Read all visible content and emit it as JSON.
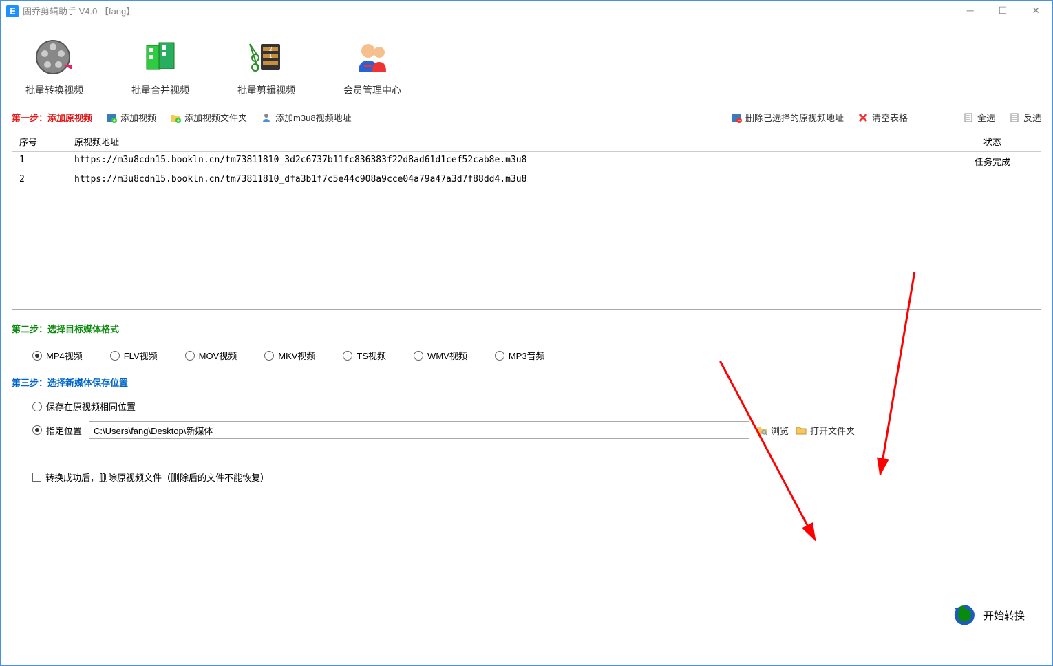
{
  "titlebar": {
    "text": "固乔剪辑助手 V4.0   【fang】"
  },
  "toolbar": {
    "convert": "批量转换视频",
    "merge": "批量合并视频",
    "clip": "批量剪辑视频",
    "member": "会员管理中心"
  },
  "step1": {
    "label": "第一步：添加原视频",
    "addVideo": "添加视频",
    "addFolder": "添加视频文件夹",
    "addM3u8": "添加m3u8视频地址",
    "delSelected": "删除已选择的原视频地址",
    "clearTable": "清空表格",
    "selectAll": "全选",
    "invert": "反选"
  },
  "table": {
    "headers": {
      "seq": "序号",
      "url": "原视频地址",
      "status": "状态"
    },
    "rows": [
      {
        "seq": "1",
        "url": "https://m3u8cdn15.bookln.cn/tm73811810_3d2c6737b11fc836383f22d8ad61d1cef52cab8e.m3u8",
        "status": "任务完成"
      },
      {
        "seq": "2",
        "url": "https://m3u8cdn15.bookln.cn/tm73811810_dfa3b1f7c5e44c908a9cce04a79a47a3d7f88dd4.m3u8",
        "status": ""
      }
    ]
  },
  "step2": {
    "label": "第二步：选择目标媒体格式",
    "options": [
      "MP4视频",
      "FLV视频",
      "MOV视频",
      "MKV视频",
      "TS视频",
      "WMV视频",
      "MP3音频"
    ]
  },
  "step3": {
    "label": "第三步：选择新媒体保存位置",
    "sameLocation": "保存在原视频相同位置",
    "customLocation": "指定位置",
    "path": "C:\\Users\\fang\\Desktop\\新媒体",
    "browse": "浏览",
    "openFolder": "打开文件夹"
  },
  "deleteAfter": "转换成功后，删除原视频文件（删除后的文件不能恢复）",
  "start": "开始转换"
}
